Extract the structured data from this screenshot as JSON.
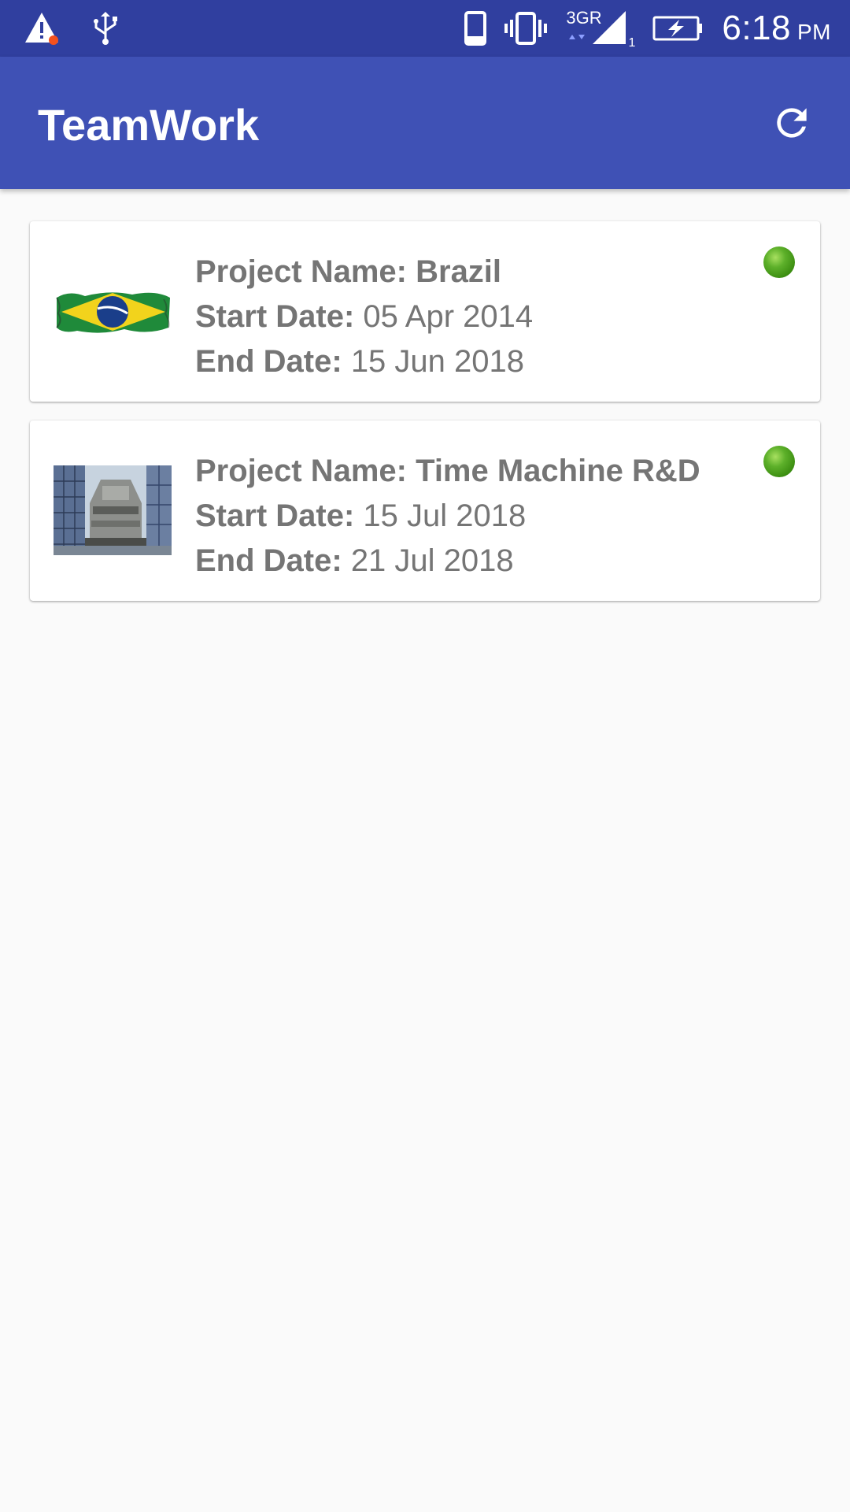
{
  "status_bar": {
    "network_label": "3GR",
    "sim_slot": "1",
    "time": "6:18",
    "ampm": "PM",
    "icons": [
      "warning-icon",
      "usb-icon",
      "phone-icon",
      "vibrate-icon",
      "signal-icon",
      "battery-charging-icon"
    ]
  },
  "app_bar": {
    "title": "TeamWork",
    "refresh_icon": "refresh-icon",
    "background_color": "#3f51b5",
    "status_bar_color": "#303f9f"
  },
  "projects": [
    {
      "name_label": "Project Name:",
      "name": "Brazil",
      "start_label": "Start Date:",
      "start_date": "05 Apr 2014",
      "end_label": "End Date:",
      "end_date": "15 Jun 2018",
      "thumbnail": "brazil-flag-image",
      "status_color": "#4caf1f"
    },
    {
      "name_label": "Project Name:",
      "name": "Time Machine R&D",
      "start_label": "Start Date:",
      "start_date": "15 Jul 2018",
      "end_label": "End Date:",
      "end_date": "21 Jul 2018",
      "thumbnail": "time-machine-image",
      "status_color": "#4caf1f"
    }
  ]
}
